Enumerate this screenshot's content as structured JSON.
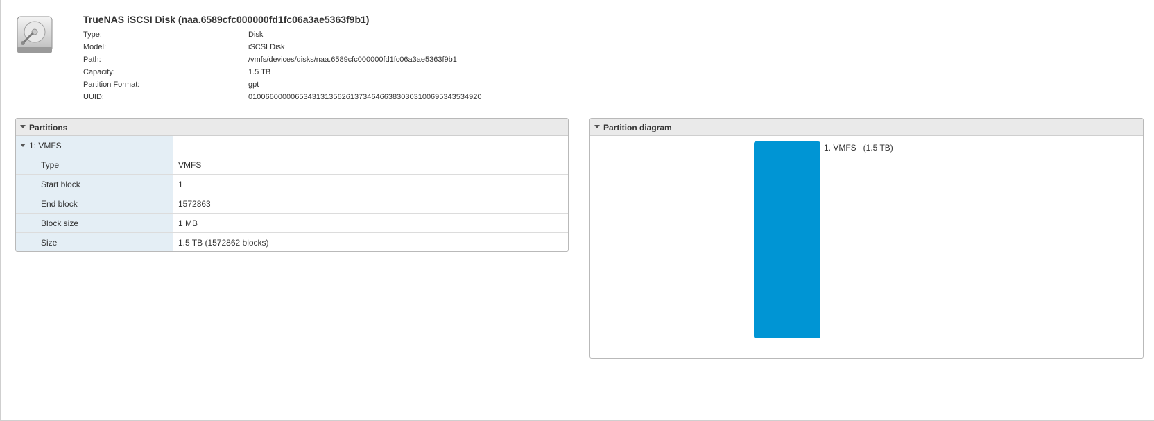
{
  "disk": {
    "title": "TrueNAS iSCSI Disk (naa.6589cfc000000fd1fc06a3ae5363f9b1)",
    "icon": "hard-disk-icon",
    "properties": [
      {
        "key": "Type:",
        "value": "Disk"
      },
      {
        "key": "Model:",
        "value": "iSCSI Disk"
      },
      {
        "key": "Path:",
        "value": "/vmfs/devices/disks/naa.6589cfc000000fd1fc06a3ae5363f9b1"
      },
      {
        "key": "Capacity:",
        "value": "1.5 TB"
      },
      {
        "key": "Partition Format:",
        "value": "gpt"
      },
      {
        "key": "UUID:",
        "value": "0100660000065343131356261373464663830303100695343534920"
      }
    ]
  },
  "partitions_panel": {
    "title": "Partitions",
    "group_label": "1: VMFS",
    "rows": [
      {
        "key": "Type",
        "value": "VMFS"
      },
      {
        "key": "Start block",
        "value": "1"
      },
      {
        "key": "End block",
        "value": "1572863"
      },
      {
        "key": "Block size",
        "value": "1 MB"
      },
      {
        "key": "Size",
        "value": "1.5 TB (1572862 blocks)"
      }
    ]
  },
  "diagram_panel": {
    "title": "Partition diagram",
    "bar_label": "1. VMFS   (1.5 TB)",
    "bar_color": "#0095d4"
  },
  "colors": {
    "accent": "#0095d4",
    "panel_header_bg": "#eaeaea",
    "key_cell_bg": "#e4eef5"
  }
}
